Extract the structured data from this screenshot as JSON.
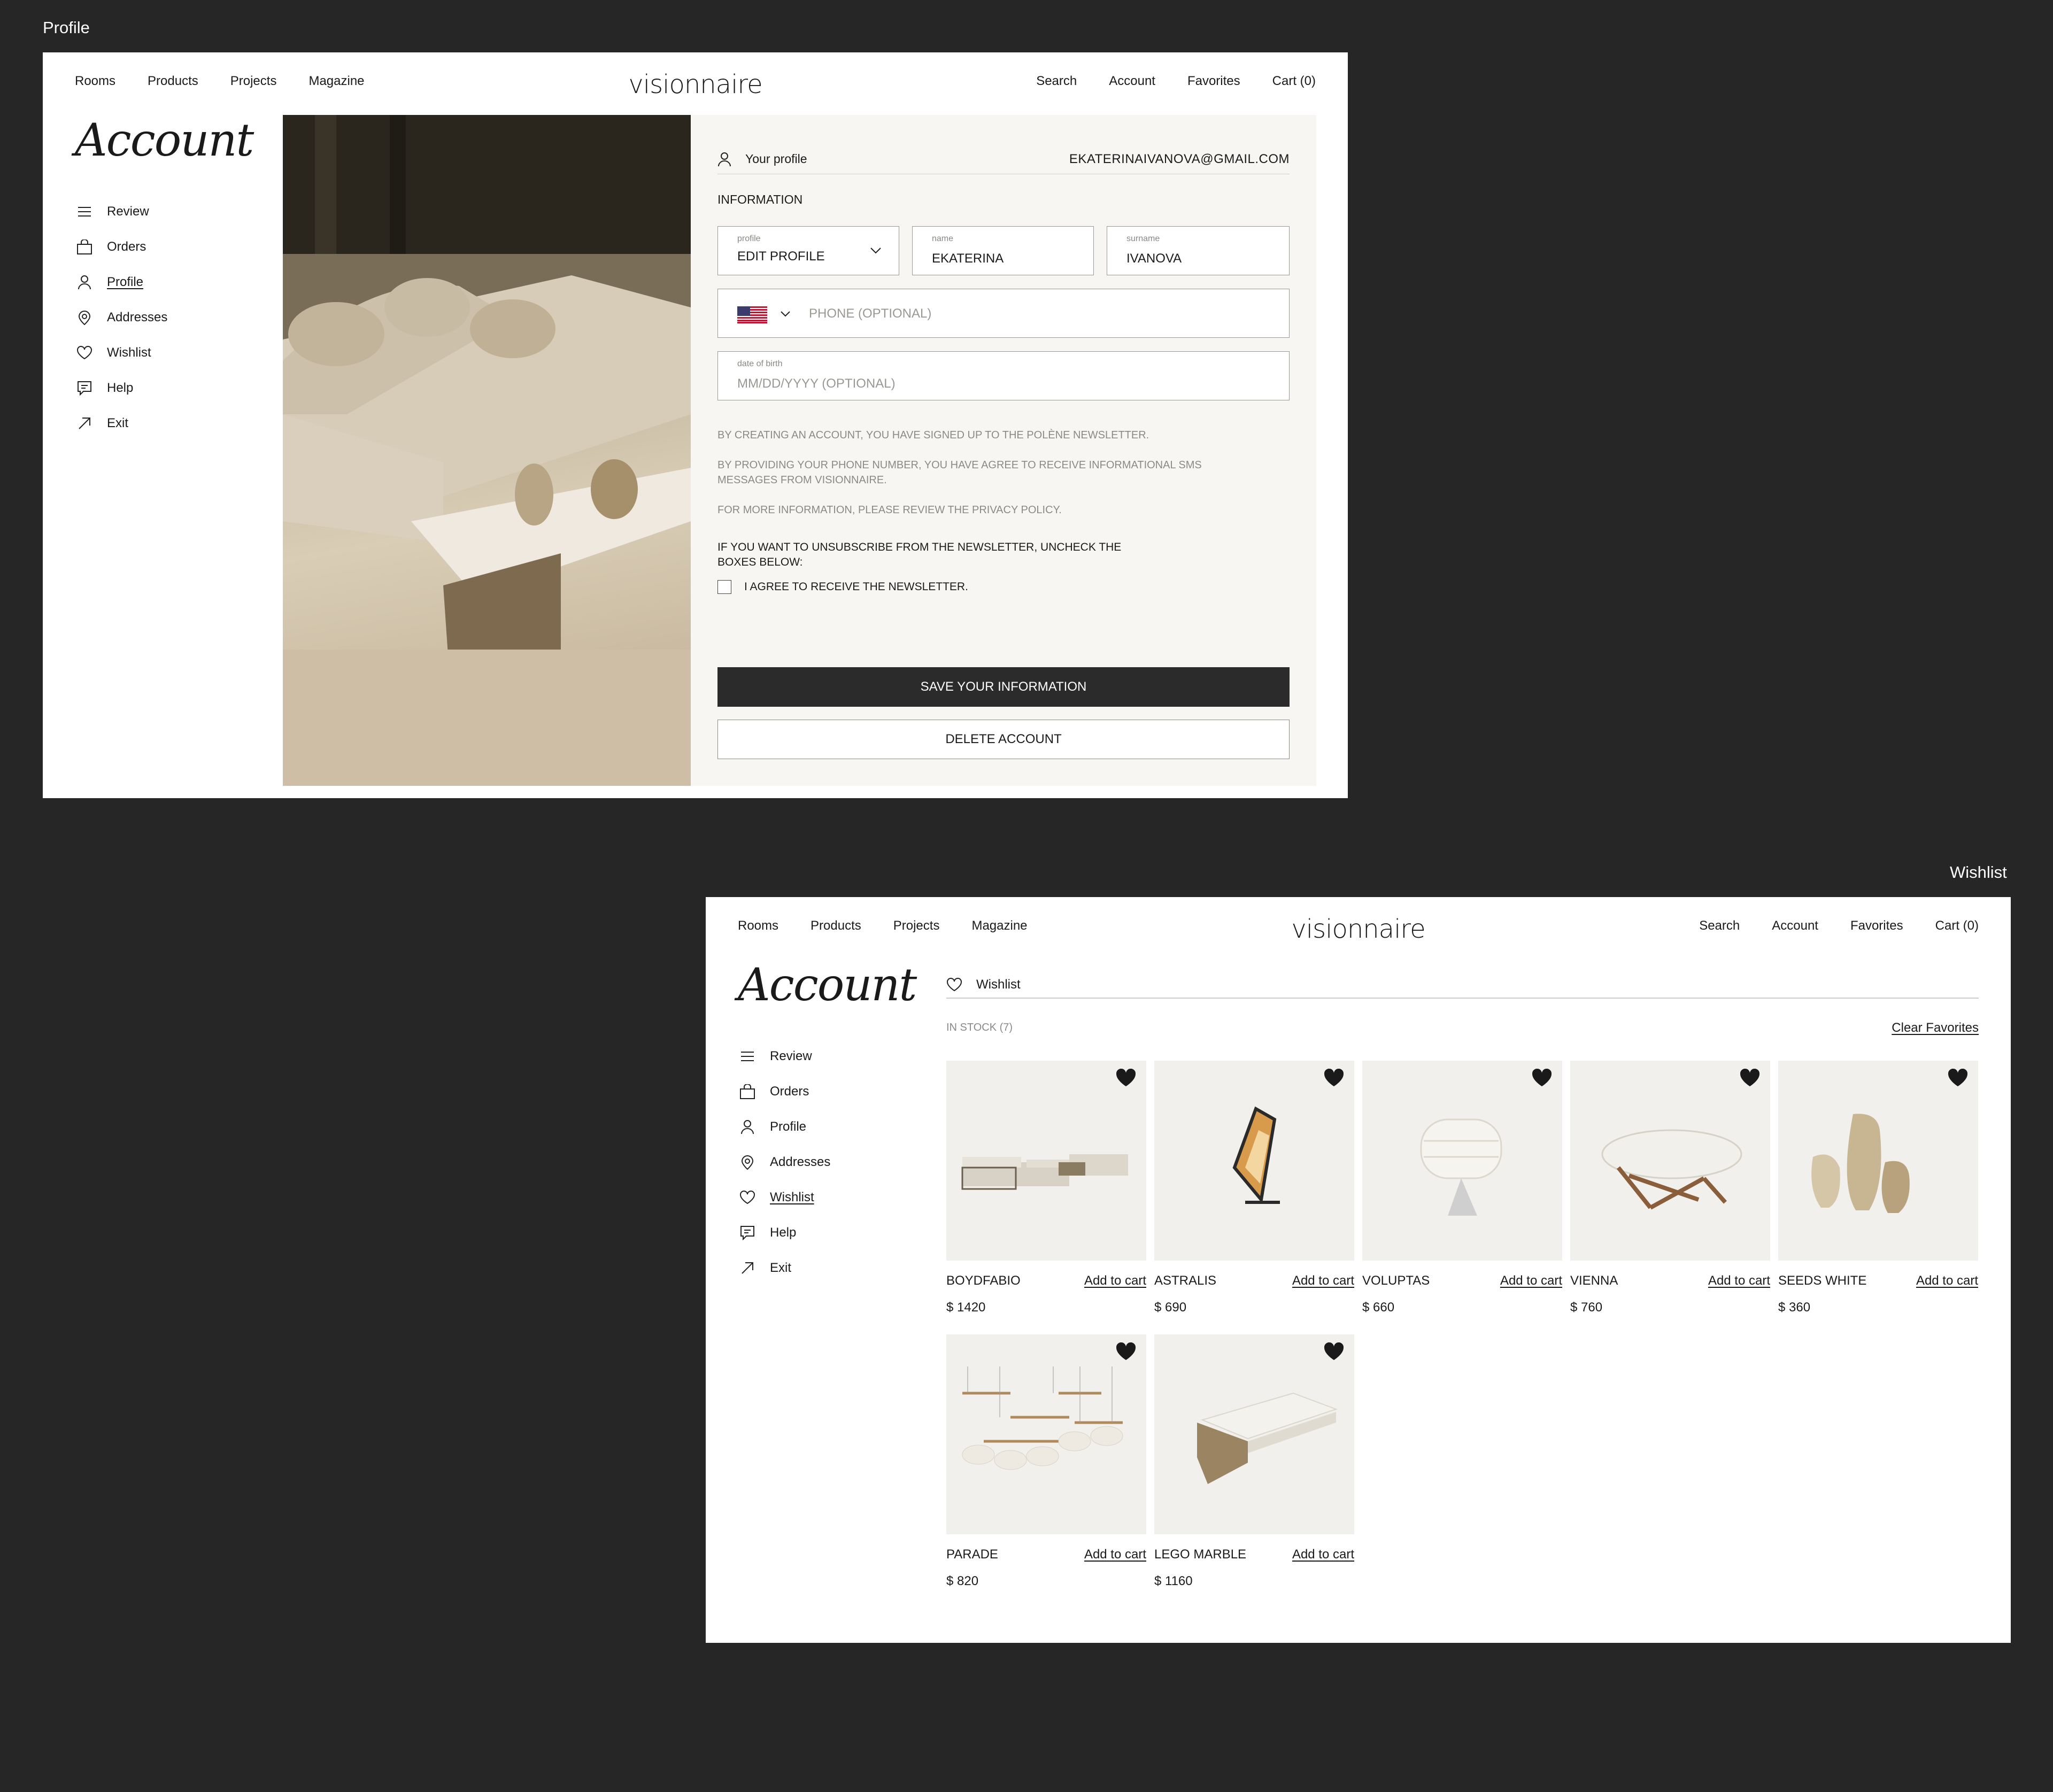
{
  "labels": {
    "profile": "Profile",
    "wishlist": "Wishlist"
  },
  "nav": {
    "rooms": "Rooms",
    "products": "Products",
    "projects": "Projects",
    "magazine": "Magazine",
    "logo": "visionnaire",
    "search": "Search",
    "account": "Account",
    "favorites": "Favorites",
    "cart": "Cart (0)"
  },
  "account": {
    "title": "Account"
  },
  "menu": {
    "review": "Review",
    "orders": "Orders",
    "profile": "Profile",
    "addresses": "Addresses",
    "wishlist": "Wishlist",
    "help": "Help",
    "exit": "Exit"
  },
  "profile": {
    "your_profile": "Your profile",
    "email": "EKATERINAIVANOVA@GMAIL.COM",
    "section": "INFORMATION",
    "profile_caption": "profile",
    "profile_value": "EDIT PROFILE",
    "name_caption": "name",
    "name_value": "EKATERINA",
    "surname_caption": "surname",
    "surname_value": "IVANOVA",
    "phone_placeholder": "PHONE (OPTIONAL)",
    "dob_caption": "date of birth",
    "dob_placeholder": "MM/DD/YYYY (OPTIONAL)",
    "note1": "BY CREATING AN ACCOUNT, YOU HAVE SIGNED UP TO THE POLÈNE NEWSLETTER.",
    "note2": "BY PROVIDING YOUR PHONE NUMBER, YOU HAVE AGREE TO RECEIVE INFORMATIONAL SMS MESSAGES FROM VISIONNAIRE.",
    "note3": "FOR MORE INFORMATION, PLEASE REVIEW THE PRIVACY POLICY.",
    "unsubscribe": "IF YOU WANT TO UNSUBSCRIBE FROM THE NEWSLETTER, UNCHECK THE BOXES BELOW:",
    "agree": "I AGREE TO RECEIVE THE NEWSLETTER.",
    "save": "SAVE YOUR INFORMATION",
    "delete": "DELETE ACCOUNT"
  },
  "wishlist": {
    "title": "Wishlist",
    "in_stock": "IN STOCK (7)",
    "clear": "Clear Favorites",
    "add_to_cart": "Add to cart",
    "items": [
      {
        "name": "BOYDFABIO",
        "price": "$ 1420"
      },
      {
        "name": "ASTRALIS",
        "price": "$ 690"
      },
      {
        "name": "VOLUPTAS",
        "price": "$ 660"
      },
      {
        "name": "VIENNA",
        "price": "$ 760"
      },
      {
        "name": "SEEDS WHITE",
        "price": "$ 360"
      },
      {
        "name": "PARADE",
        "price": "$ 820"
      },
      {
        "name": "LEGO MARBLE",
        "price": "$ 1160"
      }
    ]
  }
}
